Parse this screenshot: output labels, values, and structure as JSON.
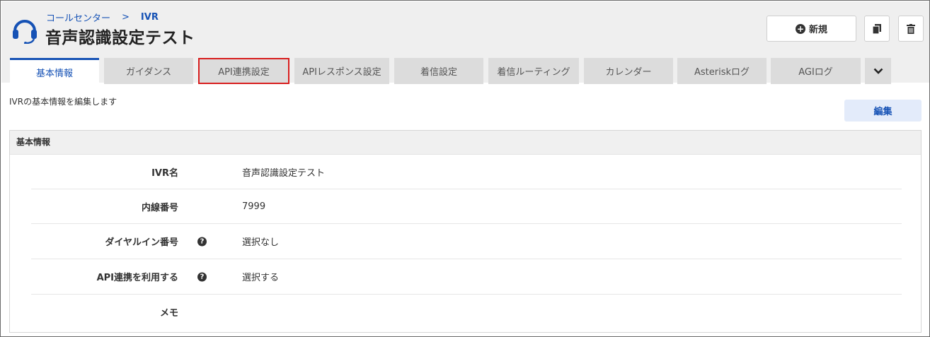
{
  "breadcrumb": {
    "parent": "コールセンター",
    "separator": ">",
    "current": "IVR"
  },
  "page_title": "音声認識設定テスト",
  "toolbar": {
    "new_label": "新規"
  },
  "tabs": [
    {
      "label": "基本情報",
      "active": true
    },
    {
      "label": "ガイダンス"
    },
    {
      "label": "API連携設定"
    },
    {
      "label": "APIレスポンス設定"
    },
    {
      "label": "着信設定"
    },
    {
      "label": "着信ルーティング"
    },
    {
      "label": "カレンダー"
    },
    {
      "label": "Asteriskログ"
    },
    {
      "label": "AGIログ"
    }
  ],
  "description": "IVRの基本情報を編集します",
  "edit_label": "編集",
  "panel": {
    "title": "基本情報",
    "rows": [
      {
        "label": "IVR名",
        "value": "音声認識設定テスト"
      },
      {
        "label": "内線番号",
        "value": "7999"
      },
      {
        "label": "ダイヤルイン番号",
        "value": "選択なし",
        "help": "?"
      },
      {
        "label": "API連携を利用する",
        "value": "選択する",
        "help": "?"
      },
      {
        "label": "メモ",
        "value": ""
      }
    ]
  },
  "colors": {
    "accent": "#1652b5",
    "highlight": "#d81e1e",
    "tab_bg": "#dcdcdc",
    "header_bg": "#efefef"
  }
}
